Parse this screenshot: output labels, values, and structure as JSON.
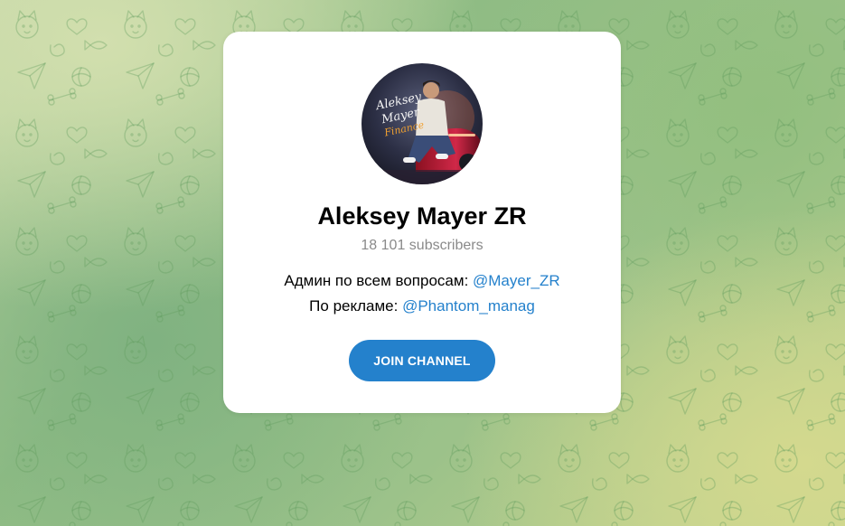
{
  "background": {
    "pattern_icon": "telegram-doodle-pattern",
    "colors": [
      "#c2d7a6",
      "#8fbc84",
      "#c8d58f"
    ]
  },
  "channel": {
    "avatar_icon": "channel-avatar-photo",
    "avatar_text": [
      "Aleksey",
      "Mayer",
      "Finance"
    ],
    "title": "Aleksey Mayer ZR",
    "subscribers": "18 101 subscribers",
    "description": {
      "line1_text": "Админ по всем вопросам: ",
      "line1_link": "@Mayer_ZR",
      "line2_text": "По рекламе: ",
      "line2_link": "@Phantom_manag"
    },
    "join_label": "JOIN CHANNEL"
  },
  "colors": {
    "accent": "#2481cc",
    "muted_text": "#8a8a8a",
    "card_bg": "#ffffff"
  }
}
